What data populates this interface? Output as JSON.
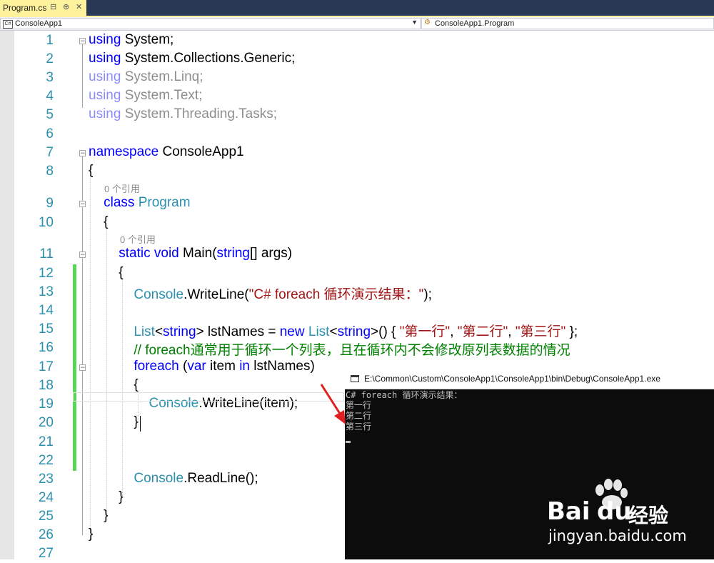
{
  "tab": {
    "filename": "Program.cs",
    "pin_icon": "pin-icon",
    "close_icon": "close-icon",
    "keep_icon": "keep-open-icon"
  },
  "navbar": {
    "project_combo": "ConsoleApp1",
    "type_combo": "ConsoleApp1.Program"
  },
  "colors": {
    "keyword": "#0000ff",
    "type": "#2b91af",
    "string": "#a31515",
    "comment": "#008000",
    "linenumber": "#2b91af"
  },
  "editor": {
    "lines": [
      {
        "n": "1",
        "tokens": [
          {
            "c": "k",
            "t": "using"
          },
          {
            "c": "n",
            "t": " System;"
          }
        ]
      },
      {
        "n": "2",
        "tokens": [
          {
            "c": "k",
            "t": "using"
          },
          {
            "c": "n",
            "t": " System.Collections.Generic;"
          }
        ]
      },
      {
        "n": "3",
        "tokens": [
          {
            "c": "k dim",
            "t": "using"
          },
          {
            "c": "n dim",
            "t": " System.Linq;"
          }
        ]
      },
      {
        "n": "4",
        "tokens": [
          {
            "c": "k dim",
            "t": "using"
          },
          {
            "c": "n dim",
            "t": " System.Text;"
          }
        ]
      },
      {
        "n": "5",
        "tokens": [
          {
            "c": "k dim",
            "t": "using"
          },
          {
            "c": "n dim",
            "t": " System.Threading.Tasks;"
          }
        ]
      },
      {
        "n": "6",
        "tokens": []
      },
      {
        "n": "7",
        "tokens": [
          {
            "c": "k",
            "t": "namespace"
          },
          {
            "c": "n",
            "t": " ConsoleApp1"
          }
        ]
      },
      {
        "n": "8",
        "tokens": [
          {
            "c": "n",
            "t": "{"
          }
        ]
      },
      {
        "n": "9",
        "tokens": [
          {
            "c": "n",
            "t": "    "
          },
          {
            "c": "k",
            "t": "class"
          },
          {
            "c": "n",
            "t": " "
          },
          {
            "c": "t",
            "t": "Program"
          }
        ]
      },
      {
        "n": "10",
        "tokens": [
          {
            "c": "n",
            "t": "    {"
          }
        ]
      },
      {
        "n": "11",
        "tokens": [
          {
            "c": "n",
            "t": "        "
          },
          {
            "c": "k",
            "t": "static"
          },
          {
            "c": "n",
            "t": " "
          },
          {
            "c": "k",
            "t": "void"
          },
          {
            "c": "n",
            "t": " Main("
          },
          {
            "c": "k",
            "t": "string"
          },
          {
            "c": "n",
            "t": "[] args)"
          }
        ]
      },
      {
        "n": "12",
        "tokens": [
          {
            "c": "n",
            "t": "        {"
          }
        ]
      },
      {
        "n": "13",
        "tokens": [
          {
            "c": "n",
            "t": "            "
          },
          {
            "c": "t",
            "t": "Console"
          },
          {
            "c": "n",
            "t": ".WriteLine("
          },
          {
            "c": "s",
            "t": "\"C# foreach 循环演示结果：\""
          },
          {
            "c": "n",
            "t": ");"
          }
        ]
      },
      {
        "n": "14",
        "tokens": []
      },
      {
        "n": "15",
        "tokens": [
          {
            "c": "n",
            "t": "            "
          },
          {
            "c": "t",
            "t": "List"
          },
          {
            "c": "n",
            "t": "<"
          },
          {
            "c": "k",
            "t": "string"
          },
          {
            "c": "n",
            "t": "> lstNames = "
          },
          {
            "c": "k",
            "t": "new"
          },
          {
            "c": "n",
            "t": " "
          },
          {
            "c": "t",
            "t": "List"
          },
          {
            "c": "n",
            "t": "<"
          },
          {
            "c": "k",
            "t": "string"
          },
          {
            "c": "n",
            "t": ">() { "
          },
          {
            "c": "s",
            "t": "\"第一行\""
          },
          {
            "c": "n",
            "t": ", "
          },
          {
            "c": "s",
            "t": "\"第二行\""
          },
          {
            "c": "n",
            "t": ", "
          },
          {
            "c": "s",
            "t": "\"第三行\""
          },
          {
            "c": "n",
            "t": " };"
          }
        ]
      },
      {
        "n": "16",
        "tokens": [
          {
            "c": "n",
            "t": "            "
          },
          {
            "c": "c",
            "t": "// foreach通常用于循环一个列表，且在循环内不会修改原列表数据的情况"
          }
        ]
      },
      {
        "n": "17",
        "tokens": [
          {
            "c": "n",
            "t": "            "
          },
          {
            "c": "k",
            "t": "foreach"
          },
          {
            "c": "n",
            "t": " ("
          },
          {
            "c": "k",
            "t": "var"
          },
          {
            "c": "n",
            "t": " item "
          },
          {
            "c": "k",
            "t": "in"
          },
          {
            "c": "n",
            "t": " lstNames)"
          }
        ]
      },
      {
        "n": "18",
        "tokens": [
          {
            "c": "n",
            "t": "            {"
          }
        ]
      },
      {
        "n": "19",
        "tokens": [
          {
            "c": "n",
            "t": "                "
          },
          {
            "c": "t",
            "t": "Console"
          },
          {
            "c": "n",
            "t": ".WriteLine(item);"
          }
        ]
      },
      {
        "n": "20",
        "tokens": [
          {
            "c": "n",
            "t": "            }"
          }
        ]
      },
      {
        "n": "21",
        "tokens": []
      },
      {
        "n": "22",
        "tokens": []
      },
      {
        "n": "23",
        "tokens": [
          {
            "c": "n",
            "t": "            "
          },
          {
            "c": "t",
            "t": "Console"
          },
          {
            "c": "n",
            "t": ".ReadLine();"
          }
        ]
      },
      {
        "n": "24",
        "tokens": [
          {
            "c": "n",
            "t": "        }"
          }
        ]
      },
      {
        "n": "25",
        "tokens": [
          {
            "c": "n",
            "t": "    }"
          }
        ]
      },
      {
        "n": "26",
        "tokens": [
          {
            "c": "n",
            "t": "}"
          }
        ]
      },
      {
        "n": "27",
        "tokens": []
      }
    ],
    "ref_hint_class": "0 个引用",
    "ref_hint_main": "0 个引用"
  },
  "console": {
    "title": "E:\\Common\\Custom\\ConsoleApp1\\ConsoleApp1\\bin\\Debug\\ConsoleApp1.exe",
    "output": [
      "C# foreach 循环演示结果：",
      "第一行",
      "第二行",
      "第三行"
    ]
  },
  "watermark": {
    "brand": "Bai",
    "brand2": "du",
    "product": "经验",
    "url": "jingyan.baidu.com"
  }
}
